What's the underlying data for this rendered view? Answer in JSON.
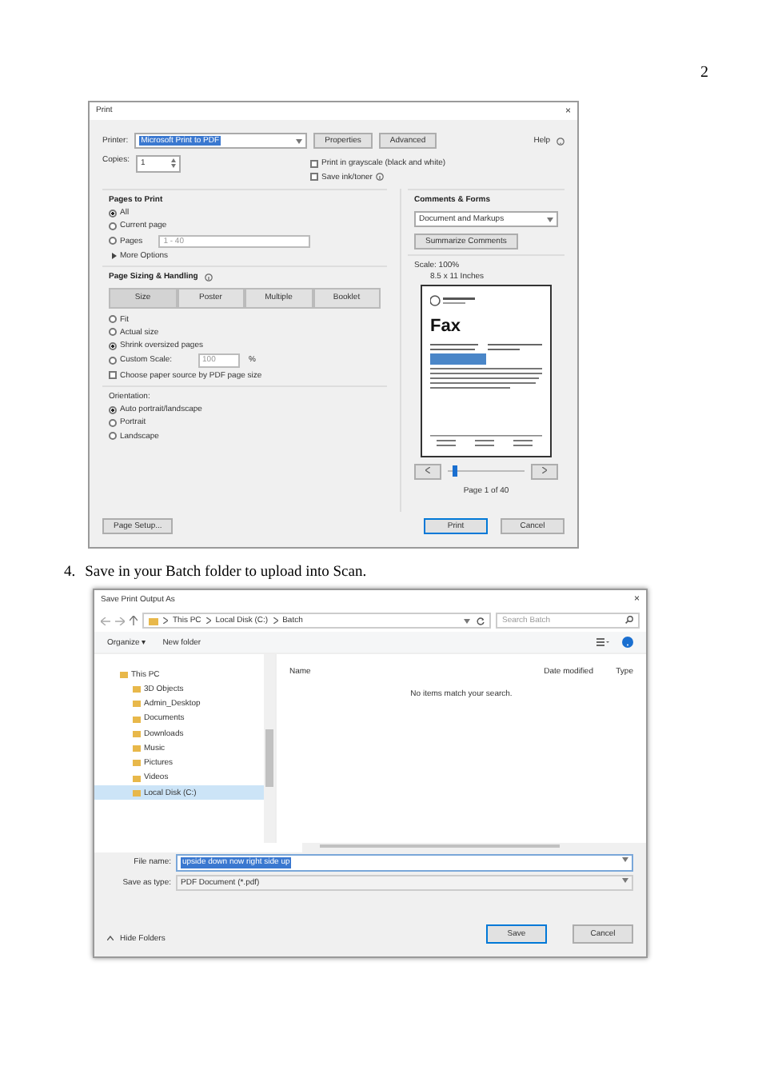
{
  "page_number": "2",
  "print_dialog": {
    "title": "Print",
    "close": "×",
    "printer_label": "Printer:",
    "printer": "Microsoft Print to PDF",
    "top_buttons": [
      "Properties",
      "Advanced"
    ],
    "help": "Help",
    "copies_label": "Copies:",
    "copies": "1",
    "options": [
      {
        "label": "Print in grayscale (black and white)",
        "checked": false
      },
      {
        "label": "Save ink/toner",
        "checked": false
      }
    ],
    "pages_to_print": {
      "title": "Pages to Print",
      "choices": [
        {
          "label": "All",
          "selected": true
        },
        {
          "label": "Current page",
          "selected": false
        },
        {
          "label": "Pages",
          "selected": false
        }
      ],
      "pages_value": "1 - 40",
      "more": "More Options"
    },
    "sizing": {
      "title": "Page Sizing & Handling",
      "tabs": [
        {
          "label": "Size",
          "selected": true
        },
        {
          "label": "Poster",
          "selected": false
        },
        {
          "label": "Multiple",
          "selected": false
        },
        {
          "label": "Booklet",
          "selected": false
        }
      ],
      "choices": [
        {
          "label": "Fit",
          "selected": false
        },
        {
          "label": "Actual size",
          "selected": false
        },
        {
          "label": "Shrink oversized pages",
          "selected": true
        },
        {
          "label": "Custom Scale:",
          "selected": false
        }
      ],
      "scale_value": "100",
      "percent": "%",
      "paper_source": {
        "label": "Choose paper source by PDF page size",
        "checked": false
      }
    },
    "orientation": {
      "title": "Orientation:",
      "choices": [
        {
          "label": "Auto portrait/landscape",
          "selected": true
        },
        {
          "label": "Portrait",
          "selected": false
        },
        {
          "label": "Landscape",
          "selected": false
        }
      ]
    },
    "comments": {
      "title": "Comments & Forms",
      "value": "Document and Markups",
      "button": "Summarize Comments"
    },
    "scale": "Scale: 100%",
    "paper": "8.5 x 11 Inches",
    "preview_heading": "Fax",
    "slider": {
      "level": 0.06
    },
    "page_info": "Page 1 of 40",
    "page_setup": "Page Setup...",
    "print": "Print",
    "cancel": "Cancel"
  },
  "step": {
    "number": "4.",
    "text": "Save in your Batch folder to upload into Scan."
  },
  "save_dialog": {
    "title": "Save Print Output As",
    "close": "×",
    "breadcrumb": [
      "This PC",
      "Local Disk (C:)",
      "Batch"
    ],
    "search_placeholder": "Search Batch",
    "toolbar": [
      "Organize ▾",
      "New folder"
    ],
    "tree": [
      {
        "label": "This PC",
        "selected": false,
        "children": [
          {
            "label": "3D Objects",
            "selected": false
          },
          {
            "label": "Admin_Desktop",
            "selected": false
          },
          {
            "label": "Documents",
            "selected": false
          },
          {
            "label": "Downloads",
            "selected": false
          },
          {
            "label": "Music",
            "selected": false
          },
          {
            "label": "Pictures",
            "selected": false
          },
          {
            "label": "Videos",
            "selected": false
          },
          {
            "label": "Local Disk (C:)",
            "selected": true
          }
        ]
      }
    ],
    "columns": [
      "Name",
      "Date modified",
      "Type"
    ],
    "empty_message": "No items match your search.",
    "file_name_label": "File name:",
    "file_name": "upside down now right side up",
    "type_label": "Save as type:",
    "type": "PDF Document (*.pdf)",
    "hide_folders": "Hide Folders",
    "save": "Save",
    "cancel": "Cancel"
  }
}
